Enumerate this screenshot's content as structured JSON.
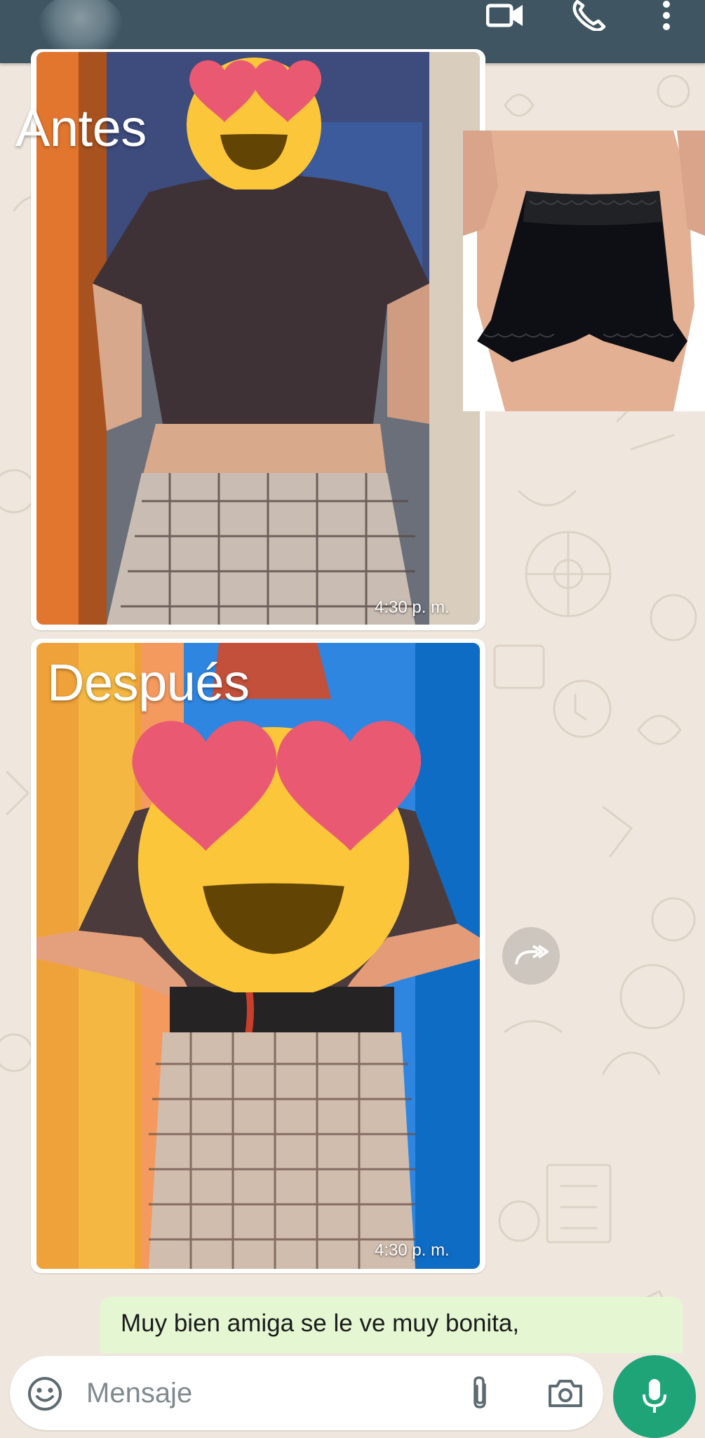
{
  "header": {
    "icons": [
      "video-call-icon",
      "phone-call-icon",
      "more-options-icon"
    ]
  },
  "messages": {
    "before_image": {
      "overlay_label": "Antes",
      "time": "4:30 p. m."
    },
    "after_image": {
      "overlay_label": "Después",
      "time": "4:30 p. m."
    },
    "reply_text": "Muy bien amiga se le ve muy bonita,"
  },
  "input_bar": {
    "placeholder": "Mensaje",
    "icons": [
      "emoji-icon",
      "attach-icon",
      "camera-icon",
      "mic-icon"
    ]
  },
  "colors": {
    "header_bg": "#3f5662",
    "wallpaper_bg": "#efe7de",
    "outgoing_bubble": "#e4f7d2",
    "mic_button": "#1fa478"
  }
}
